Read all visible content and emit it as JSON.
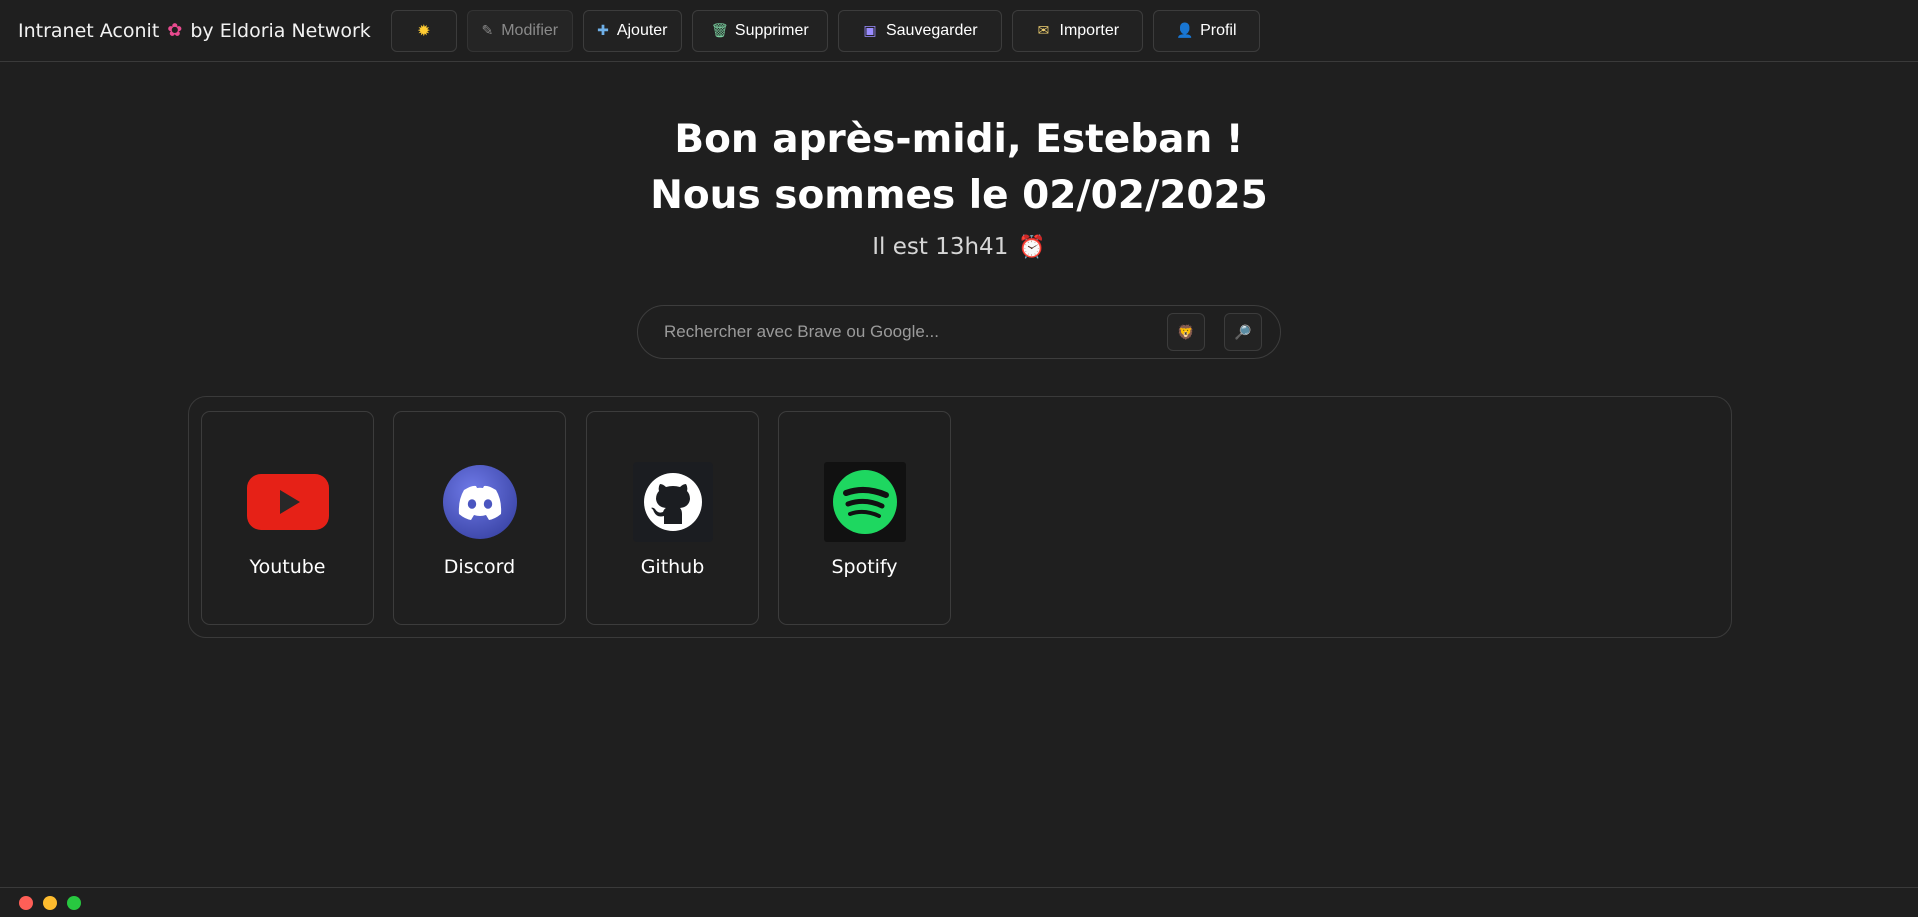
{
  "header": {
    "brand_prefix": "Intranet Aconit",
    "brand_suffix": "by Eldoria Network",
    "buttons": [
      {
        "label": "",
        "icon": "sun-icon",
        "disabled": false
      },
      {
        "label": "Modifier",
        "icon": "wrench-icon",
        "disabled": true
      },
      {
        "label": "Ajouter",
        "icon": "add-icon",
        "disabled": false
      },
      {
        "label": "Supprimer",
        "icon": "trash-icon",
        "disabled": false
      },
      {
        "label": "Sauvegarder",
        "icon": "floppy-icon",
        "disabled": false
      },
      {
        "label": "Importer",
        "icon": "import-icon",
        "disabled": false
      },
      {
        "label": "Profil",
        "icon": "person-icon",
        "disabled": false
      }
    ]
  },
  "greeting": {
    "line1_prefix": "Bon après-midi,",
    "name": "Esteban",
    "line1_suffix": "!",
    "line2": "Nous sommes le 02/02/2025",
    "time_text": "Il est 13h41"
  },
  "search": {
    "placeholder": "Rechercher avec Brave ou Google...",
    "brave_icon": "lion-icon",
    "google_icon": "magnifier-icon"
  },
  "shortcuts": [
    {
      "label": "Youtube",
      "icon": "youtube-icon",
      "color": "#e62117"
    },
    {
      "label": "Discord",
      "icon": "discord-icon",
      "color": "#5865f2"
    },
    {
      "label": "Github",
      "icon": "github-icon",
      "color": "#ffffff"
    },
    {
      "label": "Spotify",
      "icon": "spotify-icon",
      "color": "#1ed760"
    }
  ],
  "window_controls": {
    "close": "#ff5f57",
    "minimize": "#febc2e",
    "maximize": "#28c840"
  }
}
